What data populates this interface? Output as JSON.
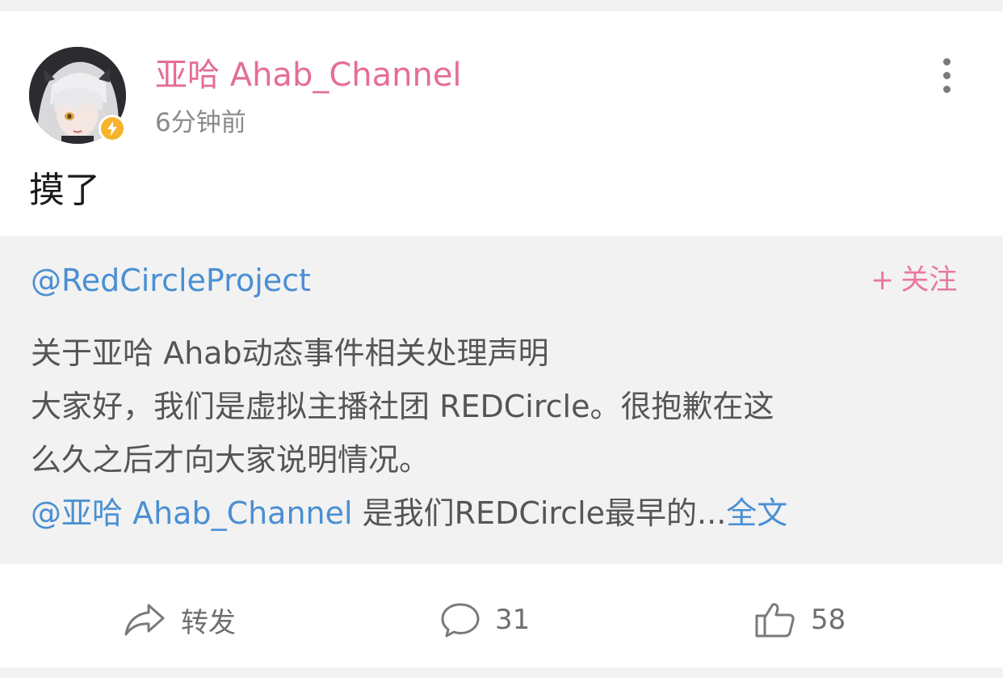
{
  "post": {
    "username": "亚哈 Ahab_Channel",
    "timestamp": "6分钟前",
    "text": "摸了",
    "avatar_icon": "avatar-image",
    "badge_icon": "lightning-badge-icon",
    "more_icon": "more-vertical-icon"
  },
  "repost": {
    "author": "@RedCircleProject",
    "follow_plus": "+",
    "follow_label": "关注",
    "lines": [
      "关于亚哈 Ahab动态事件相关处理声明",
      "大家好，我们是虚拟主播社团 REDCircle。很抱歉在这",
      "么久之后才向大家说明情况。"
    ],
    "mention": "@亚哈 Ahab_Channel",
    "last_line_text": " 是我们REDCircle最早的...",
    "fulltext_label": "全文"
  },
  "actions": {
    "repost_label": "转发",
    "repost_icon": "share-arrow-icon",
    "comment_count": "31",
    "comment_icon": "comment-bubble-icon",
    "like_count": "58",
    "like_icon": "thumbs-up-icon"
  },
  "colors": {
    "username": "#e56e92",
    "link": "#4a8fd3",
    "follow": "#e9799b",
    "repost_bg": "#f2f2f2"
  }
}
